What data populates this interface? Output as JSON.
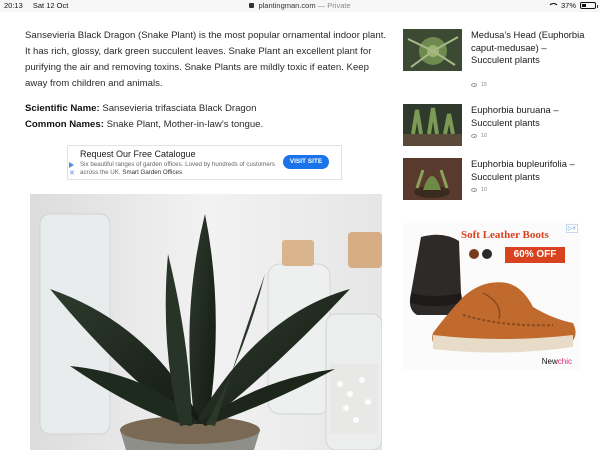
{
  "status_bar": {
    "time": "20:13",
    "date": "Sat 12 Oct",
    "domain": "plantingman.com",
    "private_label": "— Private",
    "battery": "37%",
    "battery_level": 0.37
  },
  "article": {
    "paragraph": "Sansevieria Black Dragon (Snake Plant) is the most popular ornamental indoor plant. It has rich, glossy, dark green succulent leaves. Snake Plant an excellent plant for purifying the air and removing toxins. Snake Plants are mildly toxic if eaten. Keep away from children and animals.",
    "scientific_label": "Scientific Name:",
    "scientific_value": " Sansevieria trifasciata Black Dragon",
    "common_label": "Common Names:",
    "common_value": " Snake Plant, Mother-in-law’s tongue."
  },
  "ad_banner": {
    "title": "Request Our Free Catalogue",
    "description_start": "Six beautiful ranges of garden offices. Loved by hundreds of customers across the UK. ",
    "description_strong": "Smart Garden Offices",
    "button": "VISIT SITE"
  },
  "sidebar": {
    "posts": [
      {
        "title": "Medusa’s Head (Euphorbia caput-medusae) – Succulent plants",
        "views": "15"
      },
      {
        "title": "Euphorbia buruana – Succulent plants",
        "views": "10"
      },
      {
        "title": "Euphorbia bupleurifolia – Succulent plants",
        "views": "10"
      }
    ]
  },
  "shoe_ad": {
    "headline": "Soft Leather Boots",
    "discount": "60% OFF",
    "brand_a": "New",
    "brand_b": "chic",
    "ad_flag": "▷×",
    "colors": {
      "accent": "#d9421f",
      "swatch_1": "#7a3b1e",
      "swatch_2": "#2a2a2a"
    }
  },
  "colors": {
    "link_blue": "#1a73e8",
    "text": "#2a2a2a"
  }
}
